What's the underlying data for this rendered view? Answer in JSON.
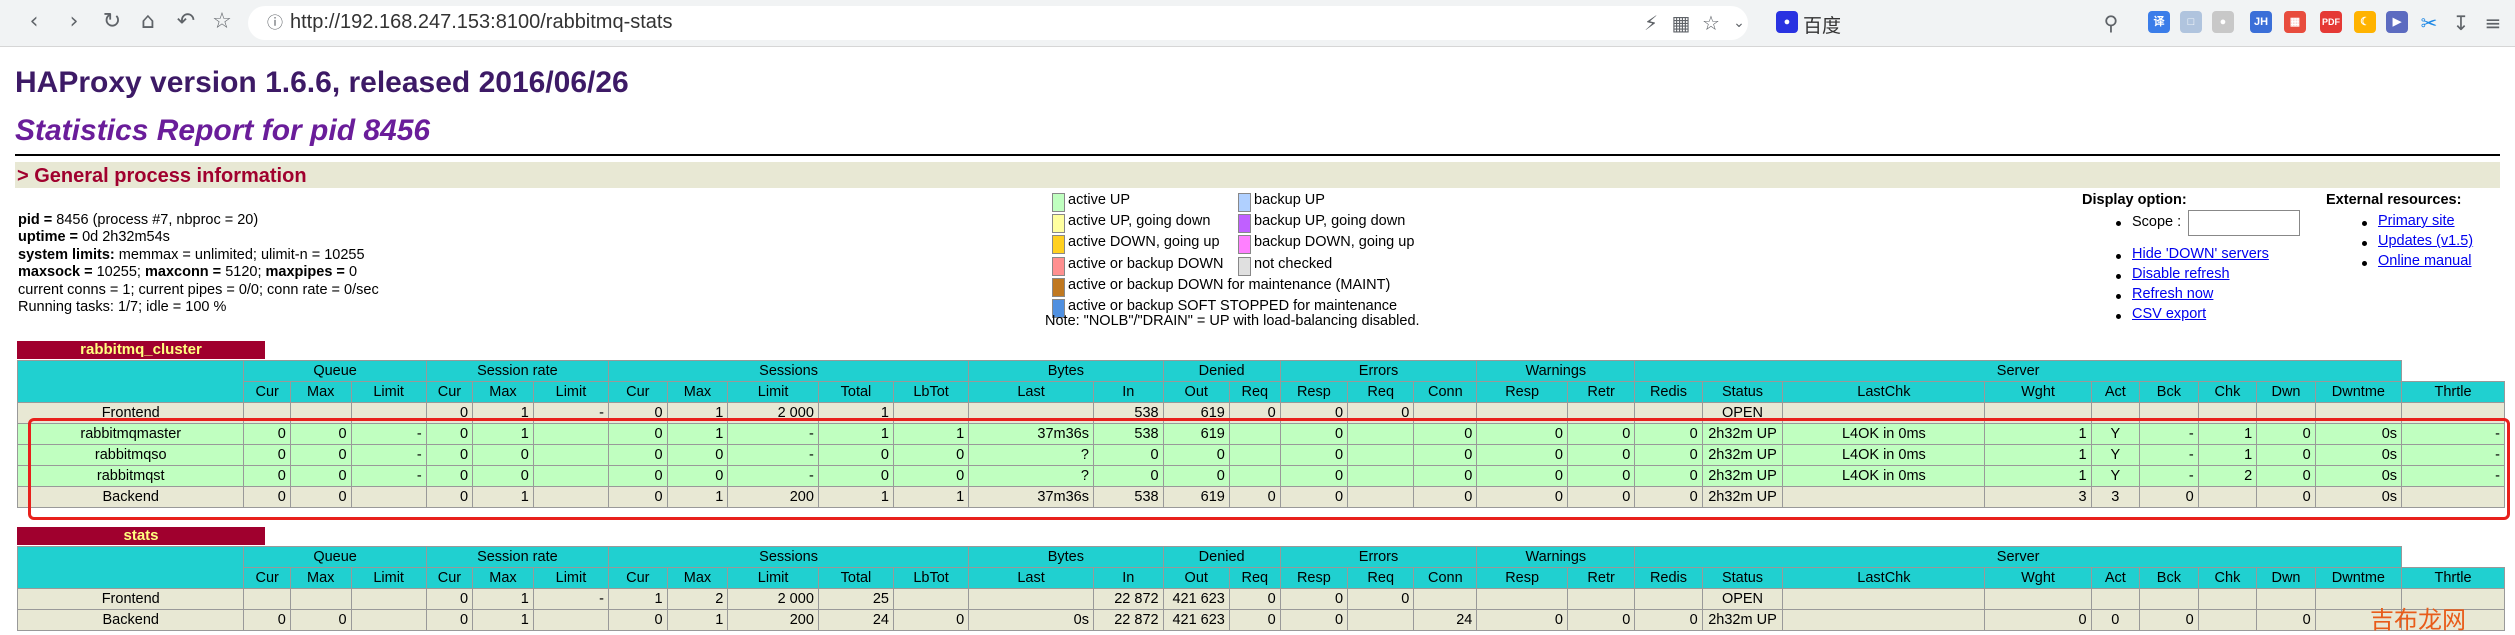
{
  "browser": {
    "url": "http://192.168.247.153:8100/rabbitmq-stats",
    "search_engine": "百度",
    "icons": [
      "back-icon",
      "forward-icon",
      "reload-icon",
      "home-icon",
      "undo-icon",
      "star-icon"
    ]
  },
  "page": {
    "title": "HAProxy version 1.6.6, released 2016/06/26",
    "subtitle": "Statistics Report for pid 8456",
    "general_header": "> General process information"
  },
  "process": {
    "l1_k": "pid = ",
    "l1_v": "8456 (process #7, nbproc = 20)",
    "l2_k": "uptime = ",
    "l2_v": "0d 2h32m54s",
    "l3_k": "system limits:",
    "l3_v": " memmax = unlimited; ulimit-n = 10255",
    "l4_k1": "maxsock = ",
    "l4_v1": "10255; ",
    "l4_k2": "maxconn = ",
    "l4_v2": "5120; ",
    "l4_k3": "maxpipes = ",
    "l4_v3": "0",
    "l5": "current conns = 1; current pipes = 0/0; conn rate = 0/sec",
    "l6": "Running tasks: 1/7; idle = 100 %"
  },
  "legend": {
    "left": [
      {
        "label": "active UP",
        "color": "#c0ffc0"
      },
      {
        "label": "active UP, going down",
        "color": "#ffffa0"
      },
      {
        "label": "active DOWN, going up",
        "color": "#ffd020"
      },
      {
        "label": "active or backup DOWN",
        "color": "#ff9090"
      },
      {
        "label": "active or backup DOWN for maintenance (MAINT)",
        "color": "#c07820"
      },
      {
        "label": "active or backup SOFT STOPPED for maintenance",
        "color": "#5090e0"
      }
    ],
    "right": [
      {
        "label": "backup UP",
        "color": "#b0d0ff"
      },
      {
        "label": "backup UP, going down",
        "color": "#c060ff"
      },
      {
        "label": "backup DOWN, going up",
        "color": "#ff80ff"
      },
      {
        "label": "not checked",
        "color": "#e0e0e0"
      }
    ],
    "note": "Note: \"NOLB\"/\"DRAIN\" = UP with load-balancing disabled."
  },
  "display_options": {
    "title": "Display option:",
    "scope_label": "Scope :",
    "links": [
      "Hide 'DOWN' servers",
      "Disable refresh",
      "Refresh now",
      "CSV export"
    ]
  },
  "external_resources": {
    "title": "External resources:",
    "links": [
      "Primary site",
      "Updates (v1.5)",
      "Online manual"
    ]
  },
  "proxies": [
    {
      "name": "rabbitmq_cluster",
      "groups": [
        "",
        "Queue",
        "Session rate",
        "Sessions",
        "Bytes",
        "Denied",
        "Errors",
        "Warnings",
        "Server"
      ],
      "cols": [
        "Cur",
        "Max",
        "Limit",
        "Cur",
        "Max",
        "Limit",
        "Cur",
        "Max",
        "Limit",
        "Total",
        "LbTot",
        "Last",
        "In",
        "Out",
        "Req",
        "Resp",
        "Req",
        "Conn",
        "Resp",
        "Retr",
        "Redis",
        "Status",
        "LastChk",
        "Wght",
        "Act",
        "Bck",
        "Chk",
        "Dwn",
        "Dwntme",
        "Thrtle"
      ],
      "rows": [
        {
          "kind": "fr",
          "cells": [
            "Frontend",
            "",
            "",
            "",
            "0",
            "1",
            "-",
            "0",
            "1",
            "2 000",
            "1",
            "",
            "",
            "538",
            "619",
            "0",
            "0",
            "0",
            "",
            "",
            "",
            "",
            "OPEN",
            "",
            "",
            "",
            "",
            "",
            "",
            "",
            ""
          ]
        },
        {
          "kind": "up",
          "cells": [
            "rabbitmqmaster",
            "0",
            "0",
            "-",
            "0",
            "1",
            "",
            "0",
            "1",
            "-",
            "1",
            "1",
            "37m36s",
            "538",
            "619",
            "",
            "0",
            "",
            "0",
            "0",
            "0",
            "0",
            "2h32m UP",
            "L4OK in 0ms",
            "1",
            "Y",
            "-",
            "1",
            "0",
            "0s",
            "-"
          ]
        },
        {
          "kind": "up",
          "cells": [
            "rabbitmqso",
            "0",
            "0",
            "-",
            "0",
            "0",
            "",
            "0",
            "0",
            "-",
            "0",
            "0",
            "?",
            "0",
            "0",
            "",
            "0",
            "",
            "0",
            "0",
            "0",
            "0",
            "2h32m UP",
            "L4OK in 0ms",
            "1",
            "Y",
            "-",
            "1",
            "0",
            "0s",
            "-"
          ]
        },
        {
          "kind": "up",
          "cells": [
            "rabbitmqst",
            "0",
            "0",
            "-",
            "0",
            "0",
            "",
            "0",
            "0",
            "-",
            "0",
            "0",
            "?",
            "0",
            "0",
            "",
            "0",
            "",
            "0",
            "0",
            "0",
            "0",
            "2h32m UP",
            "L4OK in 0ms",
            "1",
            "Y",
            "-",
            "2",
            "0",
            "0s",
            "-"
          ]
        },
        {
          "kind": "fr",
          "cells": [
            "Backend",
            "0",
            "0",
            "",
            "0",
            "1",
            "",
            "0",
            "1",
            "200",
            "1",
            "1",
            "37m36s",
            "538",
            "619",
            "0",
            "0",
            "",
            "0",
            "0",
            "0",
            "0",
            "2h32m UP",
            "",
            "3",
            "3",
            "0",
            "",
            "0",
            "0s",
            ""
          ]
        }
      ]
    },
    {
      "name": "stats",
      "groups": [
        "",
        "Queue",
        "Session rate",
        "Sessions",
        "Bytes",
        "Denied",
        "Errors",
        "Warnings",
        "Server"
      ],
      "cols": [
        "Cur",
        "Max",
        "Limit",
        "Cur",
        "Max",
        "Limit",
        "Cur",
        "Max",
        "Limit",
        "Total",
        "LbTot",
        "Last",
        "In",
        "Out",
        "Req",
        "Resp",
        "Req",
        "Conn",
        "Resp",
        "Retr",
        "Redis",
        "Status",
        "LastChk",
        "Wght",
        "Act",
        "Bck",
        "Chk",
        "Dwn",
        "Dwntme",
        "Thrtle"
      ],
      "rows": [
        {
          "kind": "fr",
          "cells": [
            "Frontend",
            "",
            "",
            "",
            "0",
            "1",
            "-",
            "1",
            "2",
            "2 000",
            "25",
            "",
            "",
            "22 872",
            "421 623",
            "0",
            "0",
            "0",
            "",
            "",
            "",
            "",
            "OPEN",
            "",
            "",
            "",
            "",
            "",
            "",
            "",
            ""
          ]
        },
        {
          "kind": "fr",
          "cells": [
            "Backend",
            "0",
            "0",
            "",
            "0",
            "1",
            "",
            "0",
            "1",
            "200",
            "24",
            "0",
            "0s",
            "22 872",
            "421 623",
            "0",
            "0",
            "",
            "24",
            "0",
            "0",
            "0",
            "2h32m UP",
            "",
            "0",
            "0",
            "0",
            "",
            "0",
            "",
            ""
          ]
        }
      ]
    }
  ],
  "watermark": "吉布龙网"
}
